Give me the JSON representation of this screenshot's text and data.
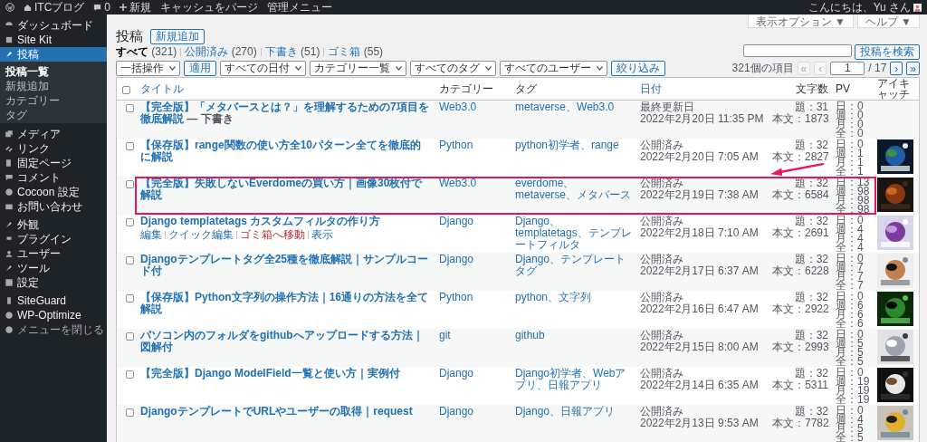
{
  "admin_bar": {
    "site": "ITCブログ",
    "comments": "0",
    "new": "新規",
    "items": [
      "キャッシュをパージ",
      "管理メニュー"
    ],
    "greeting": "こんにちは、Yu さん"
  },
  "sidebar": {
    "items": [
      {
        "label": "ダッシュボード",
        "selected": false
      },
      {
        "label": "Site Kit",
        "selected": false
      },
      {
        "label": "投稿",
        "selected": true,
        "children": [
          {
            "label": "投稿一覧",
            "selected": true
          },
          {
            "label": "新規追加",
            "selected": false
          },
          {
            "label": "カテゴリー",
            "selected": false
          },
          {
            "label": "タグ",
            "selected": false
          }
        ]
      },
      {
        "label": "メディア",
        "selected": false
      },
      {
        "label": "リンク",
        "selected": false
      },
      {
        "label": "固定ページ",
        "selected": false
      },
      {
        "label": "コメント",
        "selected": false
      },
      {
        "label": "Cocoon 設定",
        "selected": false
      },
      {
        "label": "お問い合わせ",
        "selected": false
      },
      {
        "label": "外観",
        "selected": false
      },
      {
        "label": "プラグイン",
        "selected": false
      },
      {
        "label": "ユーザー",
        "selected": false
      },
      {
        "label": "ツール",
        "selected": false
      },
      {
        "label": "設定",
        "selected": false
      },
      {
        "label": "SiteGuard",
        "selected": false
      },
      {
        "label": "WP-Optimize",
        "selected": false
      },
      {
        "label": "メニューを閉じる",
        "selected": false,
        "kind": "collapse"
      }
    ]
  },
  "screen_options": [
    "表示オプション ▼",
    "ヘルプ ▼"
  ],
  "page": {
    "title": "投稿",
    "add_new": "新規追加"
  },
  "views": [
    {
      "label": "すべて",
      "count": "(321)",
      "selected": true
    },
    {
      "label": "公開済み",
      "count": "(270)",
      "selected": false
    },
    {
      "label": "下書き",
      "count": "(51)",
      "selected": false
    },
    {
      "label": "ゴミ箱",
      "count": "(55)",
      "selected": false
    }
  ],
  "search": {
    "button": "投稿を検索"
  },
  "filters": {
    "bulk": "一括操作",
    "apply": "適用",
    "selects": [
      "すべての日付",
      "カテゴリー一覧",
      "すべてのタグ",
      "すべてのユーザー"
    ],
    "filter": "絞り込み"
  },
  "pagination": {
    "count": "321個の項目",
    "first": "«",
    "prev": "‹",
    "page": "1",
    "total": "/ 17",
    "next": "›",
    "last": "»"
  },
  "table": {
    "select_all": {
      "checked": false
    },
    "columns": [
      {
        "label": "タイトル",
        "sortable": true
      },
      {
        "label": "カテゴリー",
        "sortable": false
      },
      {
        "label": "タグ",
        "sortable": false
      },
      {
        "label": "日付",
        "sortable": true
      },
      {
        "label": "文字数",
        "sortable": false
      },
      {
        "label": "PV",
        "sortable": false
      },
      {
        "label": "アイキャッチ",
        "sortable": false
      }
    ],
    "rows": [
      {
        "checked": false,
        "highlighted": false,
        "title": "【完全版】「メタバースとは？」を理解するための7項目を徹底解説",
        "state": "— 下書き",
        "category": "Web3.0",
        "tags": "metaverse、Web3.0",
        "date_status": "最終更新日",
        "date": "2022年2月20日 11:35 PM",
        "title_chars": "題：31",
        "body_chars": "本文：1873",
        "pv": [
          "日：0",
          "週：0",
          "月：0",
          "全：0"
        ],
        "thumbnail": false
      },
      {
        "checked": false,
        "highlighted": false,
        "title": "【保存版】range関数の使い方全10パターン全てを徹底的に解説",
        "category": "Python",
        "tags": "python初学者、range",
        "date_status": "公開済み",
        "date": "2022年2月20日 7:05 AM",
        "title_chars": "題：32",
        "body_chars": "本文：2827",
        "pv": [
          "日：0",
          "週：1",
          "月：1",
          "全：1"
        ],
        "thumbnail": true
      },
      {
        "checked": false,
        "highlighted": true,
        "title": "【完全版】失敗しないEverdomeの買い方｜画像30枚付で解説",
        "category": "Web3.0",
        "tags": "everdome、metaverse、メタバース",
        "date_status": "公開済み",
        "date": "2022年2月19日 7:38 AM",
        "title_chars": "題：32",
        "body_chars": "本文：6584",
        "pv": [
          "日：13",
          "週：98",
          "月：98",
          "全：98"
        ],
        "thumbnail": true
      },
      {
        "checked": false,
        "highlighted": false,
        "title": "Django templatetags カスタムフィルタの作り方",
        "actions": [
          {
            "label": "編集",
            "kind": "normal"
          },
          {
            "label": "クイック編集",
            "kind": "normal"
          },
          {
            "label": "ゴミ箱へ移動",
            "kind": "danger"
          },
          {
            "label": "表示",
            "kind": "normal"
          }
        ],
        "category": "Django",
        "tags": "Django、templatetags、テンプレートフィルタ",
        "date_status": "公開済み",
        "date": "2022年2月18日 7:10 AM",
        "title_chars": "題：32",
        "body_chars": "本文：2691",
        "pv": [
          "日：0",
          "週：4",
          "月：4",
          "全：4"
        ],
        "thumbnail": true
      },
      {
        "checked": false,
        "highlighted": false,
        "title": "Djangoテンプレートタグ全25種を徹底解説｜サンプルコード付",
        "category": "Django",
        "tags": "Django、テンプレートタグ",
        "date_status": "公開済み",
        "date": "2022年2月17日 6:37 AM",
        "title_chars": "題：32",
        "body_chars": "本文：6228",
        "pv": [
          "日：0",
          "週：7",
          "月：7",
          "全：7"
        ],
        "thumbnail": true
      },
      {
        "checked": false,
        "highlighted": false,
        "title": "【保存版】Python文字列の操作方法｜16通りの方法を全て解説",
        "category": "Python",
        "tags": "python、文字列",
        "date_status": "公開済み",
        "date": "2022年2月16日 6:47 AM",
        "title_chars": "題：32",
        "body_chars": "本文：2922",
        "pv": [
          "日：0",
          "週：6",
          "月：6",
          "全：6"
        ],
        "thumbnail": true
      },
      {
        "checked": false,
        "highlighted": false,
        "title": "パソコン内のフォルダをgithubへアップロードする方法｜図解付",
        "category": "git",
        "tags": "github",
        "date_status": "公開済み",
        "date": "2022年2月15日 8:00 AM",
        "title_chars": "題：32",
        "body_chars": "本文：2993",
        "pv": [
          "日：0",
          "週：5",
          "月：5",
          "全：5"
        ],
        "thumbnail": true
      },
      {
        "checked": false,
        "highlighted": false,
        "title": "【完全版】Django ModelField一覧と使い方｜実例付",
        "category": "Django",
        "tags": "Django初学者、Webアプリ、日報アプリ",
        "date_status": "公開済み",
        "date": "2022年2月14日 6:35 AM",
        "title_chars": "題：32",
        "body_chars": "本文：5311",
        "pv": [
          "日：0",
          "週：19",
          "月：19",
          "全：19"
        ],
        "thumbnail": true
      },
      {
        "checked": false,
        "highlighted": false,
        "title": "DjangoテンプレートでURLやユーザーの取得｜request",
        "category": "Django",
        "tags": "Django、日報アプリ",
        "date_status": "公開済み",
        "date": "2022年2月13日 9:53 AM",
        "title_chars": "題：32",
        "body_chars": "本文：7782",
        "pv": [
          "日：0",
          "週：4",
          "月：5",
          "全：5"
        ],
        "thumbnail": true
      }
    ]
  }
}
